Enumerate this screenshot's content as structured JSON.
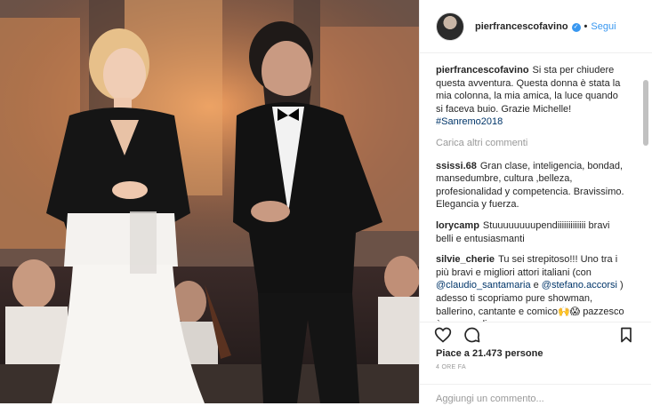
{
  "post": {
    "username": "pierfrancescofavino",
    "verified_badge": "✓",
    "separator": "•",
    "follow_label": "Segui"
  },
  "caption": {
    "username": "pierfrancescofavino",
    "text": "Si sta per chiudere questa avventura. Questa donna è stata la mia colonna, la mia amica, la luce quando si faceva buio. Grazie Michelle!",
    "hashtag": "#Sanremo2018"
  },
  "load_more_label": "Carica altri commenti",
  "comments": [
    {
      "username": "ssissi.68",
      "text": "Gran clase, inteligencia, bondad, mansedumbre, cultura ,belleza, profesionalidad y competencia. Bravissimo. Elegancia y fuerza."
    },
    {
      "username": "lorycamp",
      "text": "Stuuuuuuuupendiiiiiiiiiiiii bravi belli e entusiasmanti"
    },
    {
      "username": "silvie_cherie",
      "text_before": "Tu sei strepitoso!!! Uno tra i più bravi e migliori attori italiani (con",
      "mention1": "@claudio_santamaria",
      "text_between": " e ",
      "mention2": "@stefano.accorsi",
      "text_after": " ) adesso ti scopriamo pure showman, ballerino, cantante e comico🙌😱 pazzesco è un orgoglio e un onore conoscere persone della tua bravura❤"
    }
  ],
  "actions": {
    "like_icon": "heart-icon",
    "comment_icon": "comment-icon",
    "save_icon": "bookmark-icon"
  },
  "likes_text": "Piace a 21.473 persone",
  "timestamp": "4 ORE FA",
  "add_comment_placeholder": "Aggiungi un commento...",
  "colors": {
    "link_blue": "#3897f0",
    "hashtag_blue": "#003569",
    "muted_gray": "#999999",
    "border": "#efefef"
  }
}
